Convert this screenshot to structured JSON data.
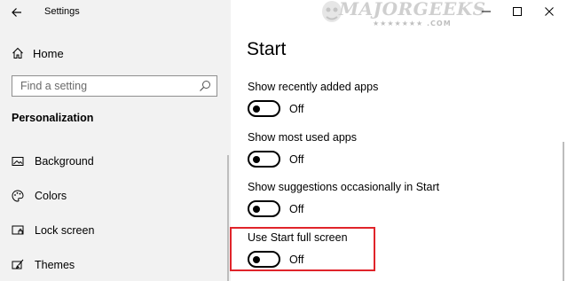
{
  "window": {
    "title": "Settings",
    "controls": {
      "minimize": "minimize-icon",
      "maximize": "maximize-icon",
      "close": "close-icon"
    }
  },
  "watermark": {
    "brand": "MAJORGEEKS",
    "sub": "★★★★★★★ .COM"
  },
  "sidebar": {
    "home_label": "Home",
    "search": {
      "placeholder": "Find a setting",
      "value": ""
    },
    "section": "Personalization",
    "items": [
      {
        "label": "Background",
        "icon": "picture-icon"
      },
      {
        "label": "Colors",
        "icon": "palette-icon"
      },
      {
        "label": "Lock screen",
        "icon": "lock-screen-icon"
      },
      {
        "label": "Themes",
        "icon": "brush-icon"
      }
    ]
  },
  "main": {
    "title": "Start",
    "settings": [
      {
        "label": "Show recently added apps",
        "state": "Off"
      },
      {
        "label": "Show most used apps",
        "state": "Off"
      },
      {
        "label": "Show suggestions occasionally in Start",
        "state": "Off"
      },
      {
        "label": "Use Start full screen",
        "state": "Off",
        "highlighted": true
      }
    ]
  },
  "colors": {
    "sidebar_bg": "#f2f2f2",
    "highlight": "#e0242a"
  }
}
